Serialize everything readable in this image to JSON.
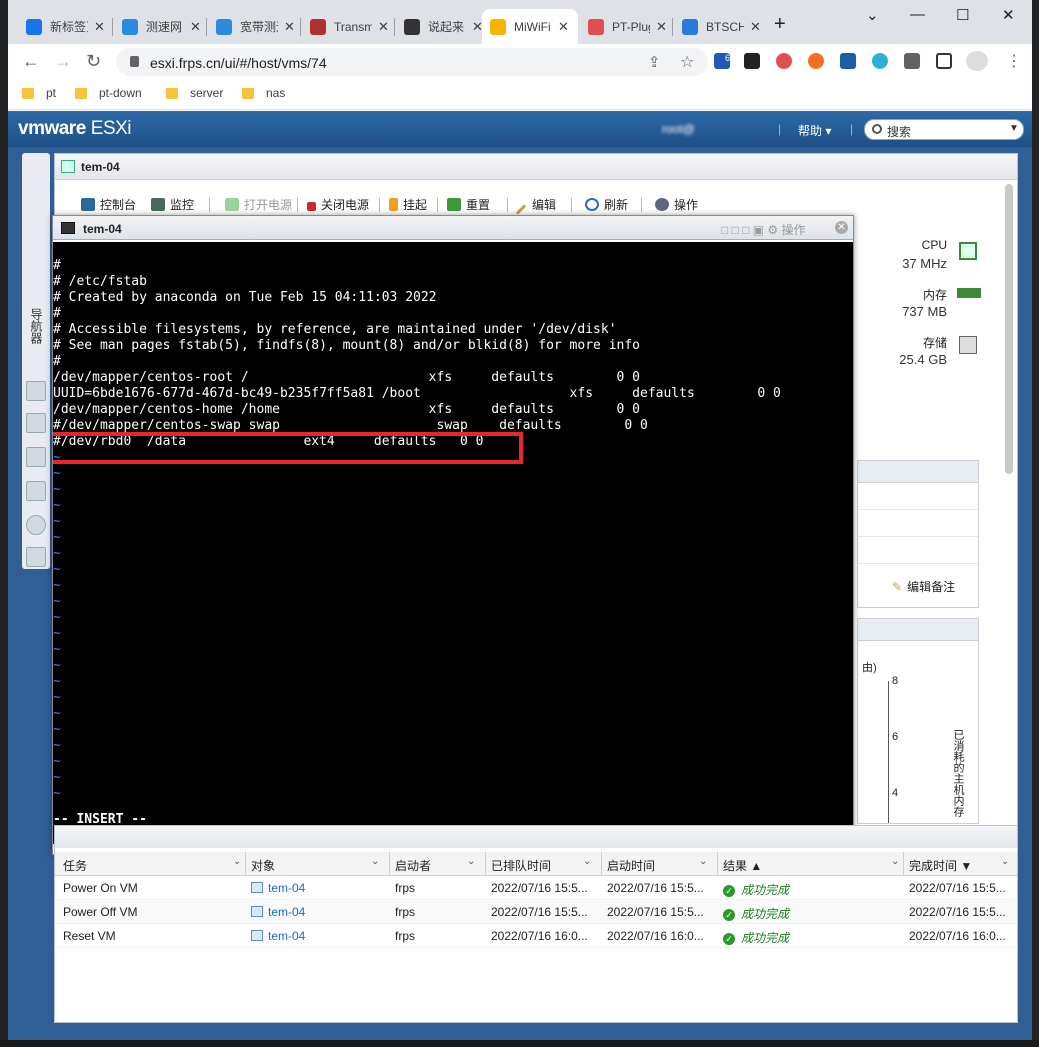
{
  "browser": {
    "tabs": [
      {
        "label": "新标签页",
        "color": "#1a73e8"
      },
      {
        "label": "测速网",
        "color": "#2b8be0"
      },
      {
        "label": "宽带测速",
        "color": "#2b8be0"
      },
      {
        "label": "Transmission",
        "color": "#b03030"
      },
      {
        "label": "说起来",
        "color": "#333333"
      },
      {
        "label": "MiWiFi",
        "color": "#f4b400"
      },
      {
        "label": "PT-Plugin",
        "color": "#e05050"
      },
      {
        "label": "BTSCHOOL",
        "color": "#2a7ad8"
      }
    ],
    "new_tab": "+",
    "url": "esxi.frps.cn/ui/#/host/vms/74",
    "extension_badge": "6",
    "bookmarks": [
      "pt",
      "pt-down",
      "server",
      "nas"
    ]
  },
  "esxi": {
    "brand": "vmware",
    "product": "ESXi",
    "user": "root@",
    "help": "帮助",
    "search_placeholder": "搜索",
    "sidebar_label": "导航器",
    "vm_title": "tem-04",
    "toolbar": [
      "控制台",
      "监控",
      "打开电源",
      "关闭电源",
      "挂起",
      "重置",
      "编辑",
      "刷新",
      "操作"
    ],
    "stats": [
      {
        "label": "CPU",
        "value": "37 MHz",
        "icon": "cpu-icon"
      },
      {
        "label": "内存",
        "value": "737 MB",
        "icon": "memory-icon"
      },
      {
        "label": "存储",
        "value": "25.4 GB",
        "icon": "storage-icon"
      }
    ],
    "edit_notes": "编辑备注",
    "chart_axis": [
      "8",
      "6",
      "4"
    ],
    "chart_ylabel": "已消耗的主机内存",
    "chart_paren": "由)"
  },
  "console": {
    "title": "tem-04",
    "actions": "操作",
    "lines": [
      "#",
      "# /etc/fstab",
      "# Created by anaconda on Tue Feb 15 04:11:03 2022",
      "#",
      "# Accessible filesystems, by reference, are maintained under '/dev/disk'",
      "# See man pages fstab(5), findfs(8), mount(8) and/or blkid(8) for more info",
      "#",
      "/dev/mapper/centos-root /                       xfs     defaults        0 0",
      "UUID=6bde1676-677d-467d-bc49-b235f7ff5a81 /boot                   xfs     defaults        0 0",
      "/dev/mapper/centos-home /home                   xfs     defaults        0 0",
      "#/dev/mapper/centos-swap swap                    swap    defaults        0 0",
      "#/dev/rbd0  /data               ext4     defaults   0 0"
    ],
    "tilde": "~",
    "status": "-- INSERT --"
  },
  "tasks": {
    "columns": [
      "任务",
      "对象",
      "启动者",
      "已排队时间",
      "启动时间",
      "结果 ▲",
      "完成时间 ▼"
    ],
    "rows": [
      {
        "task": "Power On VM",
        "target": "tem-04",
        "initiator": "frps",
        "queued": "2022/07/16 15:5...",
        "started": "2022/07/16 15:5...",
        "result": "成功完成",
        "completed": "2022/07/16 15:5..."
      },
      {
        "task": "Power Off VM",
        "target": "tem-04",
        "initiator": "frps",
        "queued": "2022/07/16 15:5...",
        "started": "2022/07/16 15:5...",
        "result": "成功完成",
        "completed": "2022/07/16 15:5..."
      },
      {
        "task": "Reset VM",
        "target": "tem-04",
        "initiator": "frps",
        "queued": "2022/07/16 16:0...",
        "started": "2022/07/16 16:0...",
        "result": "成功完成",
        "completed": "2022/07/16 16:0..."
      }
    ]
  }
}
